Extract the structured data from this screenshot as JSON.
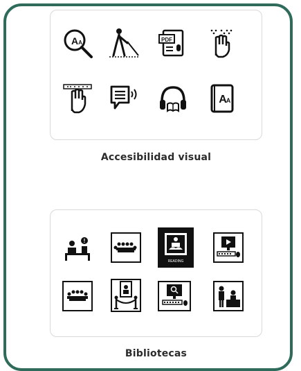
{
  "sections": {
    "visual": {
      "caption": "Accesibilidad visual",
      "icons": [
        "magnifier-text-icon",
        "blind-cane-person-icon",
        "pdf-audio-icon",
        "braille-hand-icon",
        "braille-reading-hand-icon",
        "speech-bubble-audio-icon",
        "audiobook-headphones-icon",
        "large-print-book-icon"
      ],
      "inline_texts": {
        "pdf": "PDF"
      }
    },
    "libraries": {
      "caption": "Bibliotecas",
      "icons": [
        "desk-attention-icon",
        "meeting-room-icon",
        "reading-station-icon",
        "computer-video-icon",
        "group-study-icon",
        "exhibit-rope-icon",
        "computer-search-icon",
        "librarian-counter-icon"
      ],
      "inline_texts": {
        "reading_station": "READING"
      }
    }
  },
  "colors": {
    "frame_border": "#2f6b5b",
    "card_border": "#d9d9d9",
    "icon": "#111111",
    "caption": "#2b2b2b"
  }
}
